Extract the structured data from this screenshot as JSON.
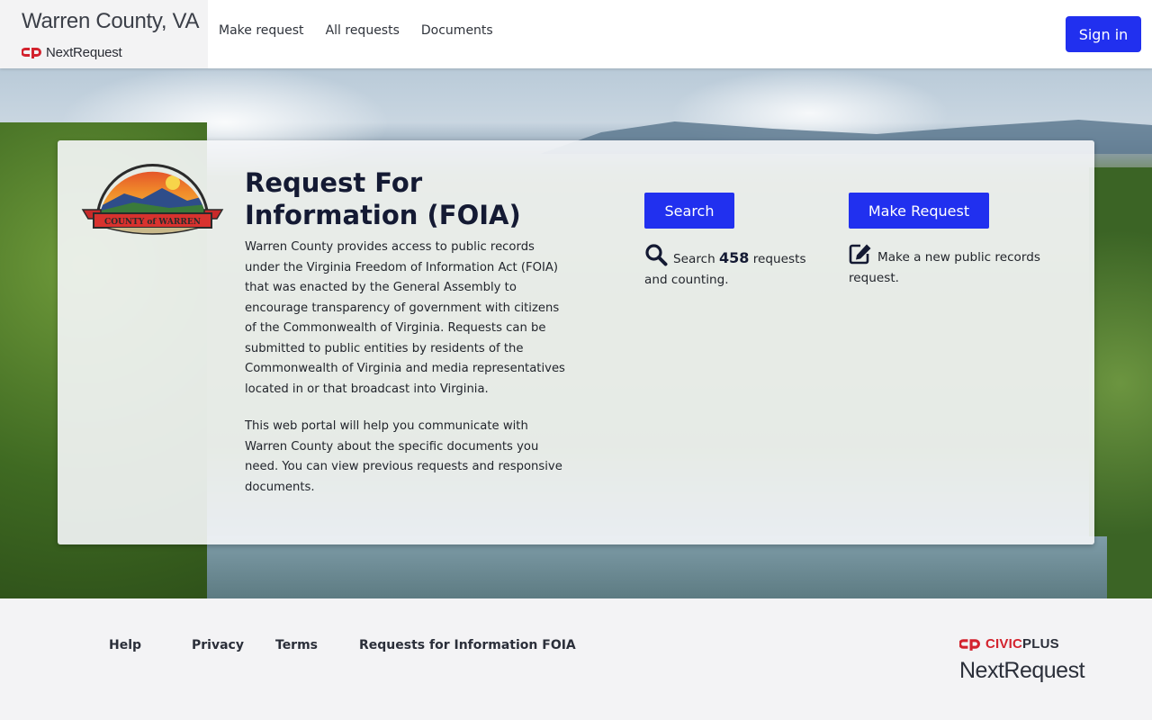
{
  "header": {
    "brand_title": "Warren County, VA",
    "brand_sub": "NextRequest",
    "nav": [
      "Make request",
      "All requests",
      "Documents"
    ],
    "signin_label": "Sign in",
    "accent_color": "#2130ef"
  },
  "hero": {
    "logo_text": "COUNTY of WARREN",
    "title": "Request For Information (FOIA)",
    "paragraphs": [
      "Warren County provides access to public records under the Virginia Freedom of Information Act (FOIA) that was enacted by the General Assembly to encourage transparency of government with citizens of the Commonwealth of Virginia. Requests can be submitted to public entities by residents of the Commonwealth of Virginia and media representatives located in or that broadcast into Virginia.",
      "This web portal will help you communicate with Warren County about the specific documents you need. You can view previous requests and responsive documents."
    ],
    "search": {
      "button_label": "Search",
      "prefix": "Search",
      "count": "458",
      "suffix": "requests and counting.",
      "icon": "search-icon"
    },
    "make_request": {
      "button_label": "Make Request",
      "text": "Make a new public records request.",
      "icon": "edit-icon"
    }
  },
  "footer": {
    "links": [
      "Help",
      "Privacy",
      "Terms",
      "Requests for Information FOIA"
    ],
    "civicplus_civic": "CIVIC",
    "civicplus_plus": "PLUS",
    "nextrequest": "NextRequest"
  }
}
